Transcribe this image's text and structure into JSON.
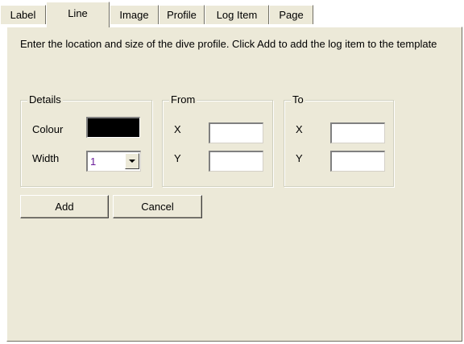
{
  "tabs": [
    {
      "label": "Label",
      "active": false
    },
    {
      "label": "Line",
      "active": true
    },
    {
      "label": "Image",
      "active": false
    },
    {
      "label": "Profile",
      "active": false
    },
    {
      "label": "Log Item",
      "active": false
    },
    {
      "label": "Page",
      "active": false
    }
  ],
  "instructions": "Enter the location and size of the dive profile.  Click Add to add the log item to the template",
  "details": {
    "title": "Details",
    "colour_label": "Colour",
    "colour_value": "#000000",
    "width_label": "Width",
    "width_value": "1"
  },
  "from": {
    "title": "From",
    "x_label": "X",
    "y_label": "Y",
    "x_value": "",
    "y_value": ""
  },
  "to": {
    "title": "To",
    "x_label": "X",
    "y_label": "Y",
    "x_value": "",
    "y_value": ""
  },
  "buttons": {
    "add": "Add",
    "cancel": "Cancel"
  }
}
